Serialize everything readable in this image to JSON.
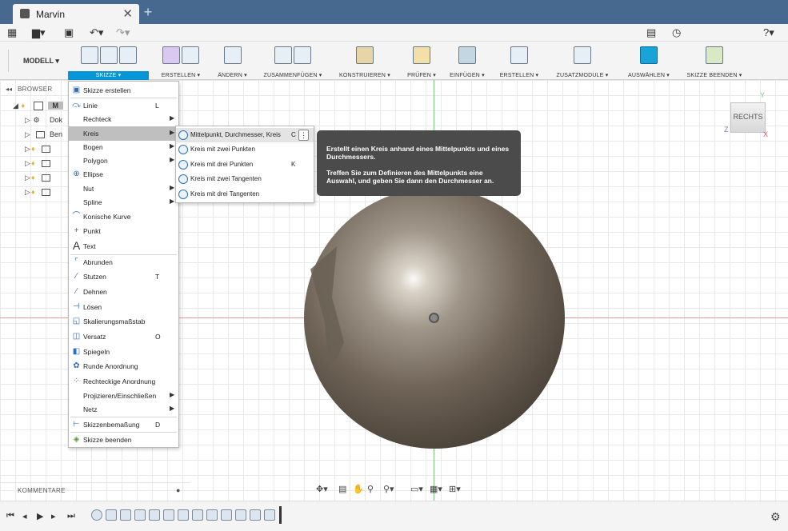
{
  "window": {
    "tab_title": "Marvin",
    "tab_close": "✕",
    "tab_add": "+"
  },
  "quickbar": {
    "help": "?▾"
  },
  "ribbon": {
    "workspace": "MODELL ▾",
    "groups": [
      {
        "label": "SKIZZE ▾",
        "active": true
      },
      {
        "label": "ERSTELLEN ▾"
      },
      {
        "label": "ÄNDERN ▾"
      },
      {
        "label": "ZUSAMMENFÜGEN ▾"
      },
      {
        "label": "KONSTRUIEREN ▾"
      },
      {
        "label": "PRÜFEN ▾"
      },
      {
        "label": "EINFÜGEN ▾"
      },
      {
        "label": "ERSTELLEN ▾"
      },
      {
        "label": "ZUSATZMODULE ▾"
      },
      {
        "label": "AUSWÄHLEN ▾"
      },
      {
        "label": "SKIZZE BEENDEN ▾"
      }
    ]
  },
  "browser": {
    "title": "BROWSER",
    "root_label": "M",
    "rows": [
      "Dok",
      "Ben"
    ]
  },
  "sketch_menu": {
    "items": [
      {
        "label": "Skizze erstellen",
        "key": "",
        "icon": "create-sketch-icon"
      },
      {
        "label": "Linie",
        "key": "L",
        "icon": "line-icon"
      },
      {
        "label": "Rechteck",
        "key": "",
        "icon": ""
      },
      {
        "label": "Kreis",
        "key": "",
        "icon": ""
      },
      {
        "label": "Bogen",
        "key": "",
        "icon": ""
      },
      {
        "label": "Polygon",
        "key": "",
        "icon": ""
      },
      {
        "label": "Ellipse",
        "key": "",
        "icon": "ellipse-icon"
      },
      {
        "label": "Nut",
        "key": "",
        "icon": ""
      },
      {
        "label": "Spline",
        "key": "",
        "icon": ""
      },
      {
        "label": "Konische Kurve",
        "key": "",
        "icon": "conic-curve-icon"
      },
      {
        "label": "Punkt",
        "key": "",
        "icon": "point-icon"
      },
      {
        "label": "Text",
        "key": "",
        "icon": "text-icon"
      },
      {
        "label": "Abrunden",
        "key": "",
        "icon": "fillet-icon"
      },
      {
        "label": "Stutzen",
        "key": "T",
        "icon": "trim-icon"
      },
      {
        "label": "Dehnen",
        "key": "",
        "icon": "extend-icon"
      },
      {
        "label": "Lösen",
        "key": "",
        "icon": "break-icon"
      },
      {
        "label": "Skalierungsmaßstab",
        "key": "",
        "icon": "scale-icon"
      },
      {
        "label": "Versatz",
        "key": "O",
        "icon": "offset-icon"
      },
      {
        "label": "Spiegeln",
        "key": "",
        "icon": "mirror-icon"
      },
      {
        "label": "Runde Anordnung",
        "key": "",
        "icon": "circular-pattern-icon"
      },
      {
        "label": "Rechteckige Anordnung",
        "key": "",
        "icon": "rectangular-pattern-icon"
      },
      {
        "label": "Projizieren/Einschließen",
        "key": "",
        "icon": ""
      },
      {
        "label": "Netz",
        "key": "",
        "icon": ""
      },
      {
        "label": "Skizzenbemaßung",
        "key": "D",
        "icon": "sketch-dimension-icon"
      },
      {
        "label": "Skizze beenden",
        "key": "",
        "icon": "finish-sketch-icon"
      }
    ]
  },
  "circle_submenu": {
    "items": [
      {
        "label": "Mittelpunkt, Durchmesser, Kreis",
        "key": "C"
      },
      {
        "label": "Kreis mit zwei Punkten",
        "key": ""
      },
      {
        "label": "Kreis mit drei Punkten",
        "key": "K"
      },
      {
        "label": "Kreis mit zwei Tangenten",
        "key": ""
      },
      {
        "label": "Kreis mit drei Tangenten",
        "key": ""
      }
    ]
  },
  "tooltip": {
    "line1": "Erstellt einen Kreis anhand eines Mittelpunkts und eines Durchmessers.",
    "line2": "Treffen Sie zum Definieren des Mittelpunkts eine Auswahl, und geben Sie dann den Durchmesser an."
  },
  "viewcube": {
    "face": "RECHTS",
    "y": "Y",
    "z": "Z",
    "x": "X"
  },
  "comments": {
    "title": "KOMMENTARE"
  },
  "colors": {
    "titlebar": "#47698f",
    "accent": "#0696d7",
    "tooltip_bg": "#4b4b4b"
  }
}
